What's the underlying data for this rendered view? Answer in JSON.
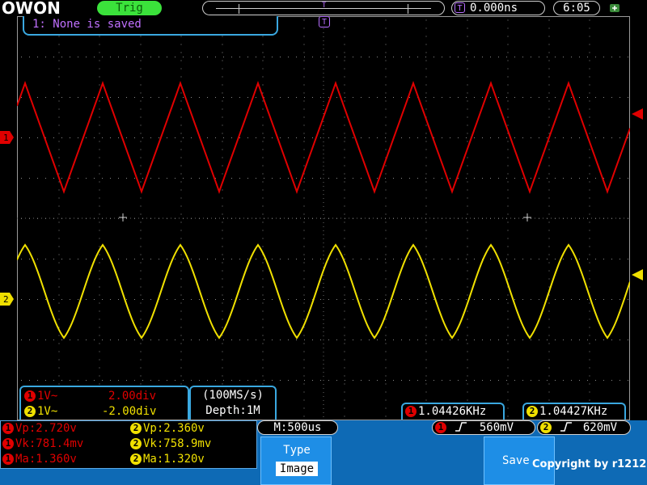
{
  "header": {
    "brand": "OWON",
    "trigger_status": "Trig",
    "trigger_position_marker": "T",
    "time_delay": "0.000ns",
    "clock": "6:05",
    "usb_icon": "usb-icon"
  },
  "screen": {
    "saved_message": "1: None is saved",
    "trigger_marker": "T",
    "ch1_marker": "1",
    "ch2_marker": "2",
    "ch1_color": "#e00000",
    "ch2_color": "#f0e000"
  },
  "channels": [
    {
      "num": "1",
      "coupling": "1V~",
      "scale": "2.00div",
      "color": "#e00000"
    },
    {
      "num": "2",
      "coupling": "1V~",
      "scale": "-2.00div",
      "color": "#f0e000"
    }
  ],
  "acquisition": {
    "sample_rate": "(100MS/s)",
    "depth": "Depth:1M"
  },
  "frequency": {
    "ch1": "1.04426KHz",
    "ch2": "1.04427KHz"
  },
  "measurements": {
    "ch1": [
      "Vp:2.720v",
      "Vk:781.4mv",
      "Ma:1.360v"
    ],
    "ch2": [
      "Vp:2.360v",
      "Vk:758.9mv",
      "Ma:1.320v"
    ]
  },
  "timebase": "M:500us",
  "trigger": {
    "ch1_level": "560mV",
    "ch2_level": "620mV"
  },
  "menu": {
    "type_label": "Type",
    "type_value": "Image",
    "save_label": "Save"
  },
  "copyright": "Copyright by r1212"
}
